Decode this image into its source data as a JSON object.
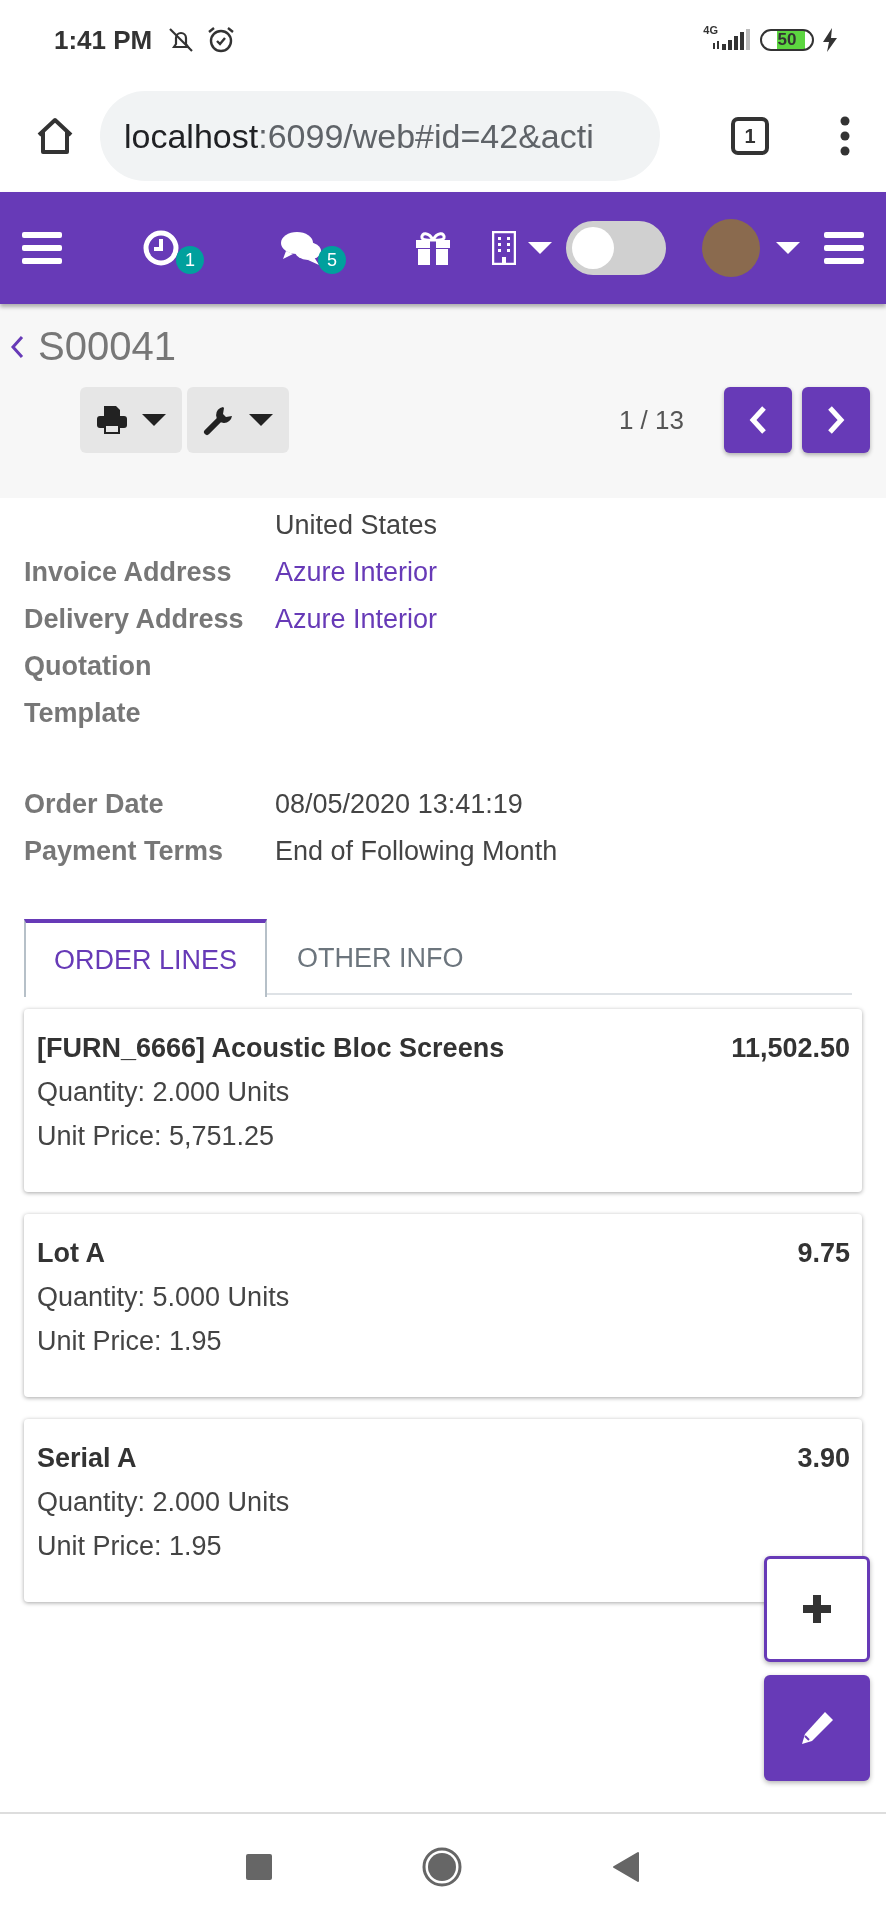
{
  "status_bar": {
    "time": "1:41 PM",
    "network": "4G",
    "battery": "50"
  },
  "browser": {
    "url_host": "localhost",
    "url_rest": ":6099/web#id=42&acti",
    "tab_count": "1"
  },
  "navbar": {
    "activity_count": "1",
    "message_count": "5",
    "toggle_on": false
  },
  "record": {
    "title": "S00041",
    "pager": "1 / 13"
  },
  "field_groups": [
    [
      {
        "kind": "text",
        "value": "United States"
      },
      {
        "kind": "link",
        "label": "Invoice Address",
        "value": "Azure Interior"
      },
      {
        "kind": "link",
        "label": "Delivery Address",
        "value": "Azure Interior"
      },
      {
        "label": "Quotation Template"
      }
    ],
    [
      {
        "kind": "text",
        "label": "Order Date",
        "value": "08/05/2020 13:41:19"
      },
      {
        "kind": "text",
        "label": "Payment Terms",
        "value": "End of Following Month"
      }
    ]
  ],
  "tabs": [
    {
      "label": "ORDER LINES",
      "selected": true
    },
    {
      "label": "OTHER INFO",
      "selected": false
    }
  ],
  "order_lines": [
    {
      "product": "[FURN_6666] Acoustic Bloc Screens",
      "subtotal": "11,502.50",
      "quantity": "Quantity: 2.000 Units",
      "unit_price": "Unit Price: 5,751.25"
    },
    {
      "product": "Lot A",
      "subtotal": "9.75",
      "quantity": "Quantity: 5.000 Units",
      "unit_price": "Unit Price: 1.95"
    },
    {
      "product": "Serial A",
      "subtotal": "3.90",
      "quantity": "Quantity: 2.000 Units",
      "unit_price": "Unit Price: 1.95"
    }
  ]
}
